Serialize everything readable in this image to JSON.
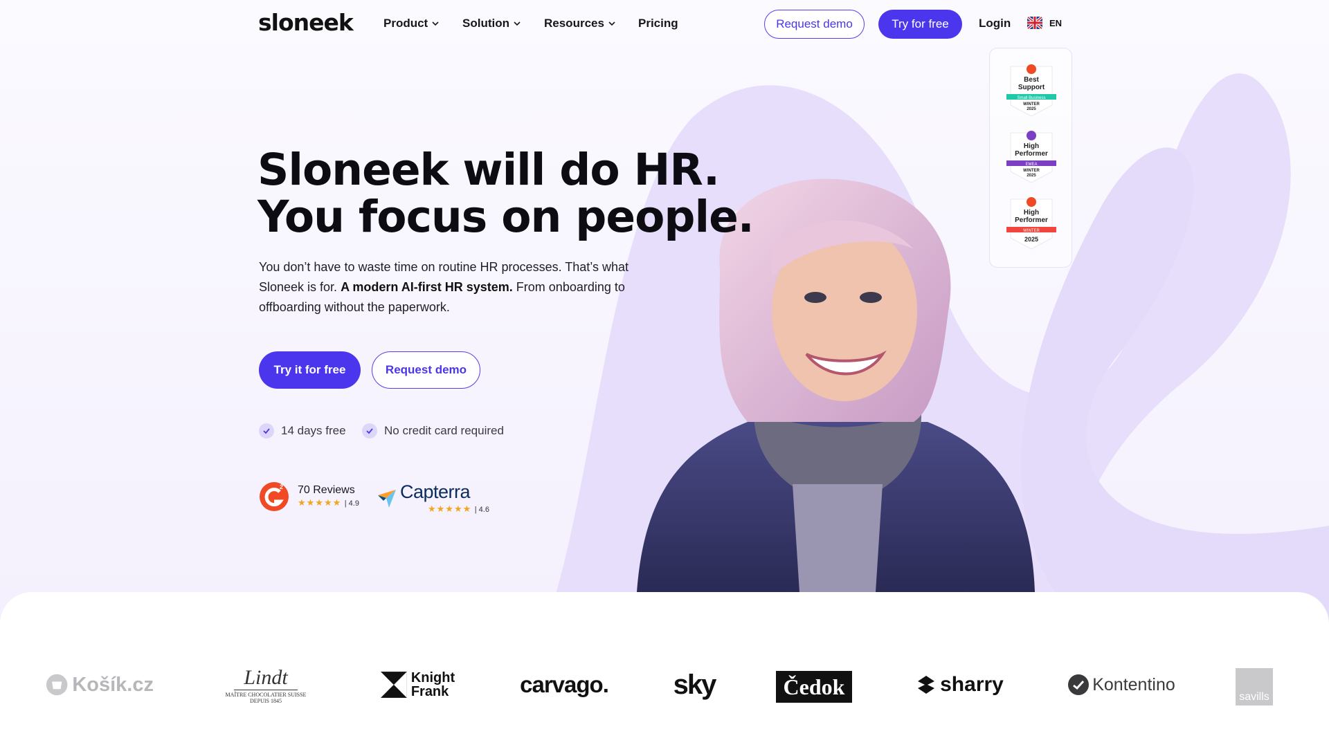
{
  "nav": {
    "logo_text": "sloneek",
    "items": [
      {
        "label": "Product",
        "has_dropdown": true
      },
      {
        "label": "Solution",
        "has_dropdown": true
      },
      {
        "label": "Resources",
        "has_dropdown": true
      },
      {
        "label": "Pricing",
        "has_dropdown": false
      }
    ],
    "request_demo": "Request demo",
    "try_free": "Try for free",
    "login": "Login",
    "language": "EN"
  },
  "hero": {
    "title_line1": "Sloneek will do HR.",
    "title_line2": "You focus on people.",
    "lead_part1": "You don’t have to waste time on routine HR processes. That’s what Sloneek is for. ",
    "lead_bold": "A modern AI-first HR system.",
    "lead_part2": " From onboarding to offboarding without the paperwork.",
    "cta_primary": "Try it for free",
    "cta_secondary": "Request demo",
    "checks": [
      "14 days free",
      "No credit card required"
    ]
  },
  "reviews": {
    "g2": {
      "count_label": "70 Reviews",
      "rating": "4.9",
      "stars": "★★★★★"
    },
    "capterra": {
      "brand": "Capterra",
      "rating": "4.6",
      "stars": "★★★★★"
    }
  },
  "badges": [
    {
      "line1": "Best",
      "line2": "Support",
      "ribbon": "Small Business",
      "season": "WINTER",
      "year": "2025",
      "ribbon_color": "#1fc9a8"
    },
    {
      "line1": "High",
      "line2": "Performer",
      "ribbon": "EMEA",
      "season": "WINTER",
      "year": "2025",
      "ribbon_color": "#7b3fc4"
    },
    {
      "line1": "High",
      "line2": "Performer",
      "ribbon": "WINTER",
      "season": "",
      "year": "2025",
      "ribbon_color": "#f2453d"
    }
  ],
  "customers": [
    "Košík.cz",
    "Lindt",
    "Knight Frank",
    "carvago.",
    "sky",
    "Čedok",
    "sharry",
    "Kontentino",
    "savills"
  ],
  "lindt_sub": "MAÎTRE CHOCOLATIER SUISSE",
  "lindt_since": "DEPUIS 1845",
  "colors": {
    "accent": "#4b36ee",
    "lavender": "#e9e1fb"
  }
}
